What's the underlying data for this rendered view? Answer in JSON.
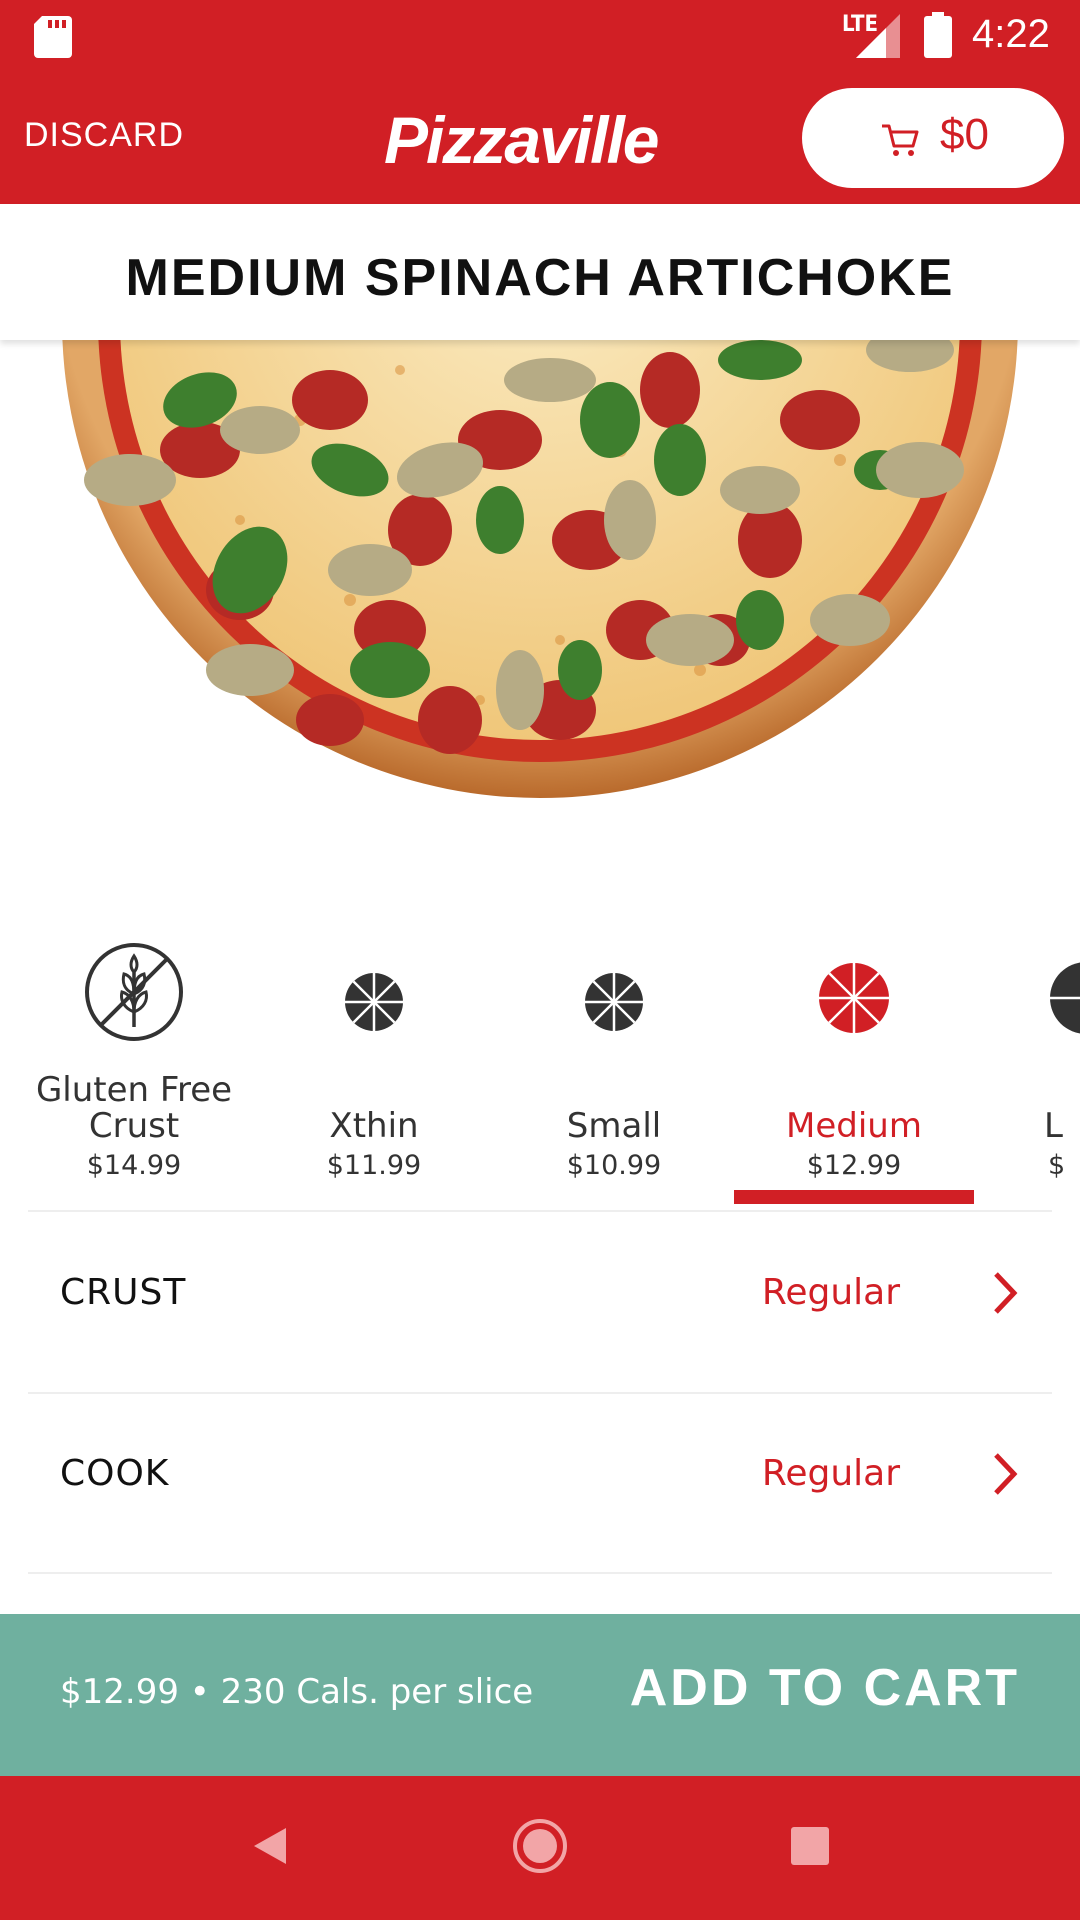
{
  "status_bar": {
    "network": "LTE",
    "time": "4:22"
  },
  "app_bar": {
    "discard_label": "DISCARD",
    "logo": "Pizzaville",
    "cart_total": "$0"
  },
  "product": {
    "title": "MEDIUM SPINACH ARTICHOKE"
  },
  "sizes": [
    {
      "name_line1": "Gluten Free",
      "name_line2": "Crust",
      "price": "$14.99",
      "icon": "gluten-free-icon",
      "selected": false
    },
    {
      "name_line1": "Xthin",
      "price": "$11.99",
      "icon": "pizza-slices-icon",
      "selected": false
    },
    {
      "name_line1": "Small",
      "price": "$10.99",
      "icon": "pizza-slices-icon",
      "selected": false
    },
    {
      "name_line1": "Medium",
      "price": "$12.99",
      "icon": "pizza-slices-icon",
      "selected": true
    },
    {
      "name_line1": "L",
      "price": "$",
      "icon": "pizza-slices-icon",
      "selected": false
    }
  ],
  "options": [
    {
      "label": "CRUST",
      "value": "Regular"
    },
    {
      "label": "COOK",
      "value": "Regular"
    }
  ],
  "cart_bar": {
    "summary": "$12.99 • 230 Cals. per slice",
    "add_label": "ADD TO CART"
  },
  "colors": {
    "brand_red": "#d11f25",
    "cart_green": "#6fb09f"
  }
}
